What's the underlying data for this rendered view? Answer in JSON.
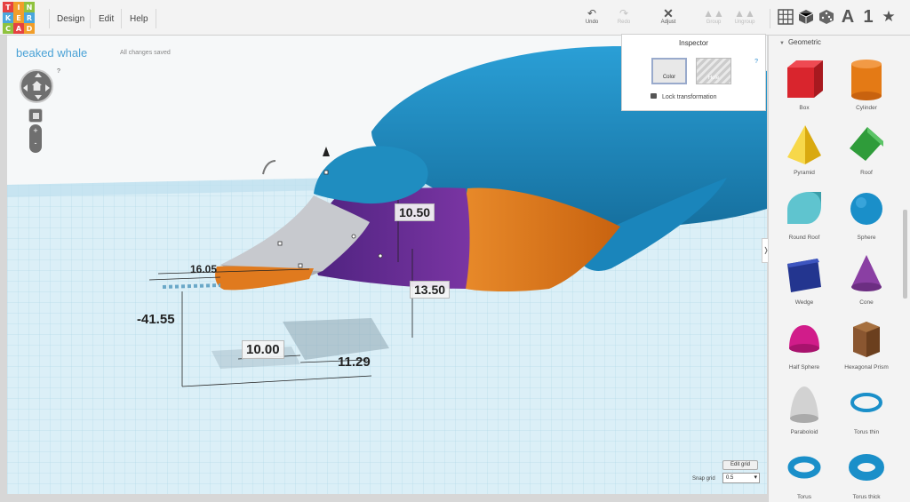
{
  "app": {
    "logo_rows": [
      [
        "T",
        "I",
        "N"
      ],
      [
        "K",
        "E",
        "R"
      ],
      [
        "C",
        "A",
        "D"
      ]
    ],
    "logo_colors": [
      "#e54242",
      "#f19e2a",
      "#8fc23e",
      "#4aa6dc",
      "#f19e2a",
      "#4aa6dc",
      "#8fc23e",
      "#e54242",
      "#f19e2a"
    ]
  },
  "menu": {
    "design": "Design",
    "edit": "Edit",
    "help": "Help"
  },
  "toolbar": {
    "undo": "Undo",
    "redo": "Redo",
    "adjust": "Adjust",
    "group": "Group",
    "ungroup": "Ungroup"
  },
  "view_tools": {
    "text": "A",
    "number": "1",
    "star": "★"
  },
  "design": {
    "title": "beaked whale",
    "save_status": "All changes saved"
  },
  "help_mark": "?",
  "inspector": {
    "title": "Inspector",
    "color_label": "Color",
    "hole_label": "Hole",
    "lock_label": "Lock transformation",
    "help": "?"
  },
  "panel": {
    "category": "Geometric",
    "shapes": [
      {
        "label": "Box",
        "icon": "box-icon",
        "color": "#d9252d"
      },
      {
        "label": "Cylinder",
        "icon": "cylinder-icon",
        "color": "#e47a15"
      },
      {
        "label": "Pyramid",
        "icon": "pyramid-icon",
        "color": "#f2c41a"
      },
      {
        "label": "Roof",
        "icon": "roof-icon",
        "color": "#2f9c3a"
      },
      {
        "label": "Round Roof",
        "icon": "round-roof-icon",
        "color": "#5fc4cf"
      },
      {
        "label": "Sphere",
        "icon": "sphere-icon",
        "color": "#1a8fc9"
      },
      {
        "label": "Wedge",
        "icon": "wedge-icon",
        "color": "#23358f"
      },
      {
        "label": "Cone",
        "icon": "cone-icon",
        "color": "#8a3fa3"
      },
      {
        "label": "Half Sphere",
        "icon": "half-sphere-icon",
        "color": "#d11c8a"
      },
      {
        "label": "Hexagonal Prism",
        "icon": "hexagonal-prism-icon",
        "color": "#8a5630"
      },
      {
        "label": "Paraboloid",
        "icon": "paraboloid-icon",
        "color": "#d2d2d2"
      },
      {
        "label": "Torus thin",
        "icon": "torus-thin-icon",
        "color": "#1a8fc9"
      },
      {
        "label": "Torus",
        "icon": "torus-icon",
        "color": "#1a8fc9"
      },
      {
        "label": "Torus thick",
        "icon": "torus-thick-icon",
        "color": "#1a8fc9"
      }
    ]
  },
  "dimensions": {
    "d1": "10.50",
    "d2": "13.50",
    "d3": "16.05",
    "d4": "-41.55",
    "d5": "10.00",
    "d6": "11.29"
  },
  "grid": {
    "edit_label": "Edit grid",
    "snap_label": "Snap grid",
    "snap_value": "0.5"
  },
  "colors": {
    "whale_body": "#1f8dc0",
    "purple": "#6a2e92",
    "orange": "#e07a1e",
    "beak": "#c7c9ce",
    "grid_plane": "#c6e4f0"
  }
}
